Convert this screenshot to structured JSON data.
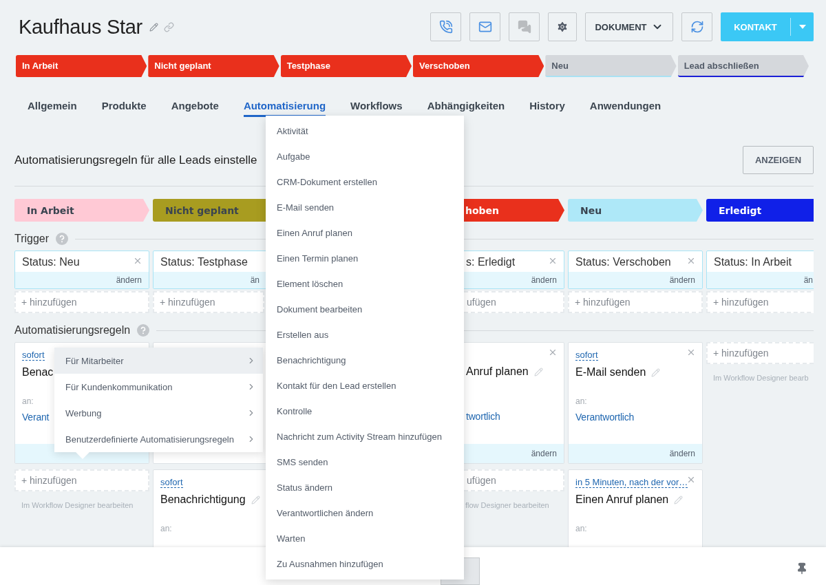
{
  "header": {
    "title": "Kaufhaus Star",
    "actions": [
      {
        "kind": "phone",
        "disabled": false
      },
      {
        "kind": "mail",
        "disabled": false
      },
      {
        "kind": "chat",
        "disabled": true
      },
      {
        "kind": "settings",
        "disabled": false
      }
    ],
    "document_button": {
      "label": "DOKUMENT"
    },
    "contact_button": {
      "label": "KONTAKT"
    }
  },
  "stages": [
    {
      "label": "In Arbeit",
      "filled": true,
      "color": "#e9301c"
    },
    {
      "label": "Nicht geplant",
      "filled": true,
      "color": "#e9301c"
    },
    {
      "label": "Testphase",
      "filled": true,
      "color": "#e9301c"
    },
    {
      "label": "Verschoben",
      "filled": true,
      "color": "#e9301c"
    },
    {
      "label": "Neu",
      "filled": false,
      "color": "#a9e2f3"
    },
    {
      "label": "Lead abschließen",
      "filled": false,
      "color": "#1a1fd6"
    }
  ],
  "tabs": [
    {
      "label": "Allgemein",
      "selected": false
    },
    {
      "label": "Produkte",
      "selected": false
    },
    {
      "label": "Angebote",
      "selected": false
    },
    {
      "label": "Automatisierung",
      "selected": true
    },
    {
      "label": "Workflows",
      "selected": false
    },
    {
      "label": "Abhängigkeiten",
      "selected": false
    },
    {
      "label": "History",
      "selected": false
    },
    {
      "label": "Anwendungen",
      "selected": false
    }
  ],
  "section": {
    "title": "Automatisierungsregeln für alle Leads einstelle",
    "button": "ANZEIGEN"
  },
  "trigger_heading": "Trigger",
  "rules_heading": "Automatisierungsregeln",
  "columns": [
    {
      "kind": "full",
      "stage": {
        "label": "In Arbeit",
        "color": "#ffc9d5"
      },
      "trigger": {
        "label": "Status: Neu",
        "action": "ändern",
        "removable": true
      },
      "trigger_add": "+ hinzufügen",
      "rules": [
        {
          "kind": "card",
          "delay": "sofort",
          "title": "Benac",
          "to_label": "an:",
          "recipient": "Verant"
        }
      ],
      "rule_add": "+ hinzufügen",
      "designer": "Im Workflow Designer bearbeiten"
    },
    {
      "kind": "cut_right",
      "stage": {
        "label": "Nicht geplant",
        "color": "#a89c20"
      },
      "trigger": {
        "label": "Status: Testphase",
        "action": "än"
      },
      "trigger_add": "+ hinzufügen",
      "rules": [
        {
          "kind": "covered"
        },
        {
          "kind": "card",
          "delay": "sofort",
          "title": "Benachrichtigung",
          "editable": true,
          "to_label": "an:"
        }
      ]
    },
    {
      "kind": "covered"
    },
    {
      "kind": "partial",
      "stage": {
        "label": "hoben",
        "color": "#e9301c"
      },
      "trigger": {
        "label": "s: Erledigt",
        "action": "ändern",
        "removable": true
      },
      "trigger_add": "ufügen",
      "rules": [
        {
          "kind": "card",
          "title": "Anruf planen",
          "editable": true,
          "removable": true,
          "recipient": "twortlich",
          "action": "ändern"
        }
      ],
      "rule_add": "ufügen",
      "designer": "flow Designer bearbeiten"
    },
    {
      "kind": "full",
      "stage": {
        "label": "Neu",
        "color": "#aee8f8"
      },
      "trigger": {
        "label": "Status: Verschoben",
        "action": "ändern",
        "removable": true
      },
      "trigger_add": "+ hinzufügen",
      "rules": [
        {
          "kind": "card",
          "delay": "sofort",
          "title": "E-Mail senden",
          "editable": true,
          "removable": true,
          "to_label": "an:",
          "recipient": "Verantwortlich",
          "action": "ändern"
        },
        {
          "kind": "card",
          "delay": "in 5 Minuten, nach der vor…",
          "title": "Einen Anruf planen",
          "editable": true,
          "removable": true,
          "to_label": "an:"
        }
      ]
    },
    {
      "kind": "cut_right",
      "stage": {
        "label": "Erledigt",
        "color": "#1020e8"
      },
      "trigger": {
        "label": "Status: In Arbeit",
        "action": "än"
      },
      "trigger_add": "+ hinzufügen",
      "rule_add": "+ hinzufügen",
      "designer": "Im Workflow Designer bearb"
    }
  ],
  "menu": {
    "items": [
      {
        "label": "Aktivität"
      },
      {
        "label": "Aufgabe"
      },
      {
        "label": "CRM-Dokument erstellen"
      },
      {
        "label": "E-Mail senden"
      },
      {
        "label": "Einen Anruf planen"
      },
      {
        "label": "Einen Termin planen"
      },
      {
        "label": "Element löschen"
      },
      {
        "label": "Dokument bearbeiten"
      },
      {
        "label": "Erstellen aus"
      },
      {
        "label": "Benachrichtigung"
      },
      {
        "label": "Kontakt für den Lead erstellen"
      },
      {
        "label": "Kontrolle"
      },
      {
        "label": "Nachricht zum Activity Stream hinzufügen"
      },
      {
        "label": "SMS senden"
      },
      {
        "label": "Status ändern"
      },
      {
        "label": "Verantwortlichen ändern"
      },
      {
        "label": "Warten"
      },
      {
        "label": "Zu Ausnahmen hinzufügen"
      }
    ]
  },
  "submenu": {
    "items": [
      {
        "label": "Für Mitarbeiter",
        "selected": true
      },
      {
        "label": "Für Kundenkommunikation",
        "selected": false
      },
      {
        "label": "Werbung",
        "selected": false
      },
      {
        "label": "Benutzerdefinierte Automatisierungsregeln",
        "selected": false
      }
    ]
  }
}
